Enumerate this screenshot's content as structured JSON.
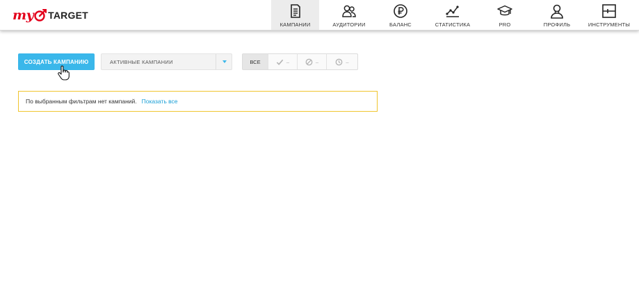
{
  "brand": {
    "logo_my": "my",
    "logo_target": "TARGET",
    "accent": "#3ab7ea",
    "logo_red": "#e3001b"
  },
  "nav": {
    "active": "campaigns",
    "items": [
      {
        "id": "campaigns",
        "label": "Кампании",
        "icon": "document-icon"
      },
      {
        "id": "audiences",
        "label": "Аудитории",
        "icon": "users-icon"
      },
      {
        "id": "balance",
        "label": "Баланс",
        "icon": "ruble-icon"
      },
      {
        "id": "statistics",
        "label": "Статистика",
        "icon": "line-chart-icon"
      },
      {
        "id": "pro",
        "label": "PRO",
        "icon": "graduation-cap-icon"
      },
      {
        "id": "profile",
        "label": "Профиль",
        "icon": "person-icon"
      },
      {
        "id": "tools",
        "label": "Инструменты",
        "icon": "tools-icon"
      }
    ]
  },
  "toolbar": {
    "create_label": "Создать кампанию",
    "filter_value": "Активные кампании",
    "status_filter": {
      "all_label": "Все",
      "active_count": "–",
      "blocked_count": "–",
      "pending_count": "–",
      "icons": [
        "check-icon",
        "blocked-icon",
        "clock-icon"
      ]
    }
  },
  "notice": {
    "text": "По выбранным фильтрам нет кампаний.",
    "link": "Показать все",
    "border_color": "#f0c52e"
  }
}
